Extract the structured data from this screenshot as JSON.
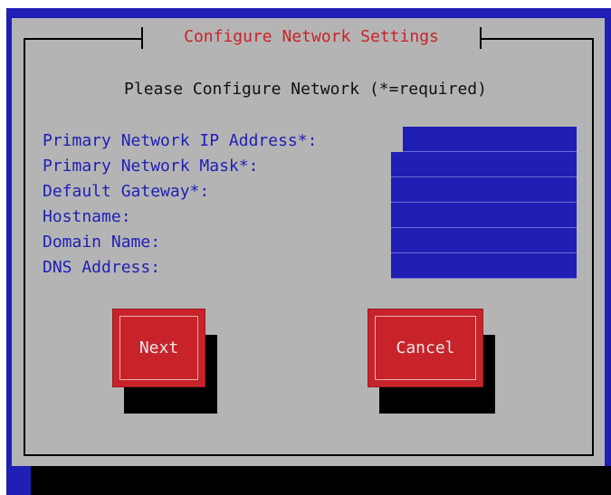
{
  "dialog": {
    "title": "Configure Network Settings",
    "prompt": "Please Configure Network (*=required)",
    "fields": [
      {
        "label": "Primary Network IP Address*:",
        "value": ""
      },
      {
        "label": "Primary Network Mask*:",
        "value": ""
      },
      {
        "label": "Default Gateway*:",
        "value": ""
      },
      {
        "label": "Hostname:",
        "value": ""
      },
      {
        "label": "Domain Name:",
        "value": ""
      },
      {
        "label": "DNS Address:",
        "value": ""
      }
    ],
    "buttons": {
      "next": "Next",
      "cancel": "Cancel"
    }
  },
  "colors": {
    "background": "#1f1fb5",
    "dialog": "#b4b4b4",
    "title_text": "#c8232a",
    "label_text": "#1f1fb5",
    "field": "#1f1fb5",
    "button": "#c8232a",
    "shadow": "#000000"
  }
}
